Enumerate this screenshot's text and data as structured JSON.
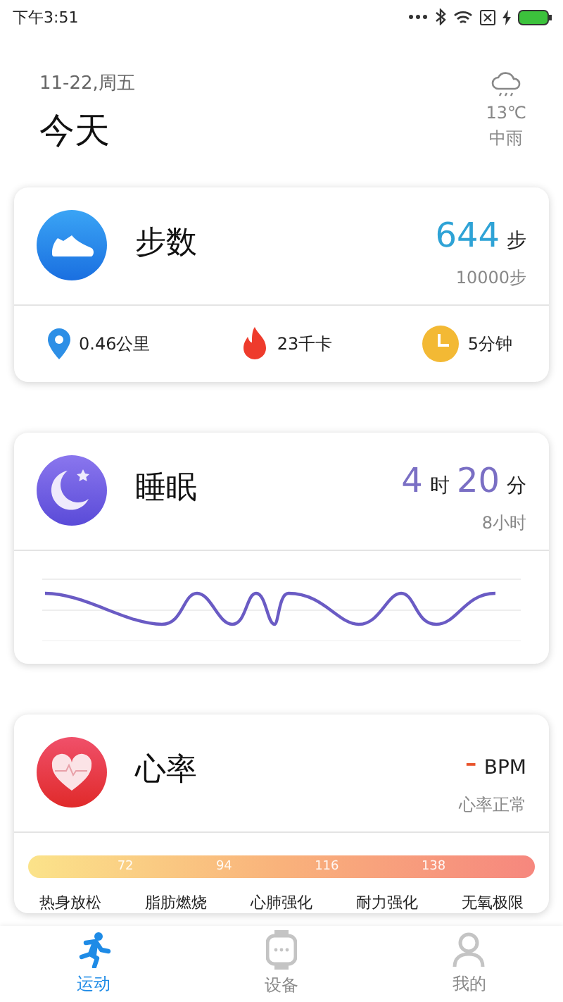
{
  "status_bar": {
    "time": "下午3:51"
  },
  "header": {
    "date": "11-22,周五",
    "title": "今天",
    "weather": {
      "temperature": "13℃",
      "condition": "中雨"
    }
  },
  "steps_card": {
    "title": "步数",
    "value": "644",
    "unit": "步",
    "goal": "10000步",
    "stats": [
      {
        "text": "0.46公里"
      },
      {
        "text": "23千卡"
      },
      {
        "text": "5分钟"
      }
    ]
  },
  "sleep_card": {
    "title": "睡眠",
    "hours": "4",
    "hours_unit": "时",
    "minutes": "20",
    "minutes_unit": "分",
    "goal": "8小时"
  },
  "heart_card": {
    "title": "心率",
    "value": "-",
    "unit": "BPM",
    "status": "心率正常",
    "ticks": [
      "72",
      "94",
      "116",
      "138"
    ],
    "zones": [
      "热身放松",
      "脂肪燃烧",
      "心肺强化",
      "耐力强化",
      "无氧极限"
    ]
  },
  "nav": [
    {
      "label": "运动",
      "selected": true
    },
    {
      "label": "设备",
      "selected": false
    },
    {
      "label": "我的",
      "selected": false
    }
  ]
}
